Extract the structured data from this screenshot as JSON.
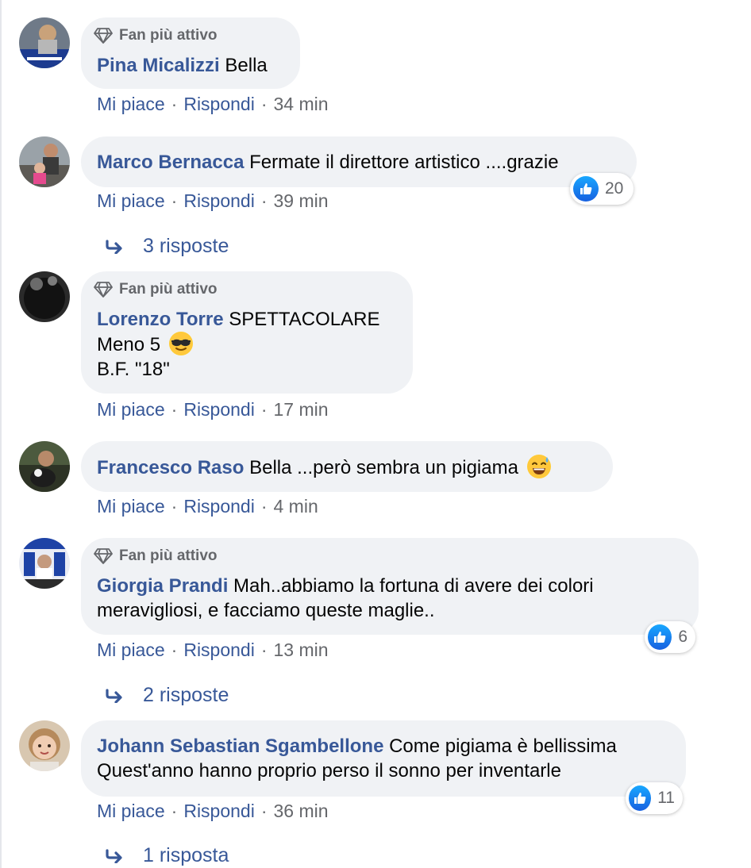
{
  "fan_badge_label": "Fan più attivo",
  "actions": {
    "like": "Mi piace",
    "reply": "Rispondi",
    "separator": "·"
  },
  "colors": {
    "author_blue": "#385898",
    "bubble_bg": "#f0f2f5",
    "meta_gray": "#65676b",
    "like_blue": "#1877f2"
  },
  "comments": [
    {
      "author": "Pina Micalizzi",
      "text_lines": [
        "Bella"
      ],
      "time": "34 min",
      "top_fan": true
    },
    {
      "author": "Marco Bernacca",
      "text_lines": [
        "Fermate il direttore artistico ....grazie"
      ],
      "time": "39 min",
      "top_fan": false,
      "reaction_count": "20",
      "replies": "3 risposte"
    },
    {
      "author": "Lorenzo Torre",
      "text_lines": [
        "SPETTACOLARE",
        "Meno 5",
        "B.F. \"18\""
      ],
      "emoji": "smiling-face-with-sunglasses",
      "time": "17 min",
      "top_fan": true
    },
    {
      "author": "Francesco Raso",
      "text_lines": [
        "Bella ...però sembra un pigiama"
      ],
      "emoji": "grinning-face-with-sweat",
      "time": "4 min",
      "top_fan": false
    },
    {
      "author": "Giorgia Prandi",
      "text_lines": [
        "Mah..abbiamo la fortuna di avere dei colori",
        "meravigliosi, e facciamo queste maglie.."
      ],
      "time": "13 min",
      "top_fan": true,
      "reaction_count": "6",
      "replies": "2 risposte"
    },
    {
      "author": "Johann Sebastian Sgambellone",
      "text_lines": [
        "Come pigiama è bellissima",
        "Quest'anno hanno proprio perso il sonno per inventarle"
      ],
      "time": "36 min",
      "top_fan": false,
      "reaction_count": "11",
      "replies": "1 risposta"
    }
  ]
}
